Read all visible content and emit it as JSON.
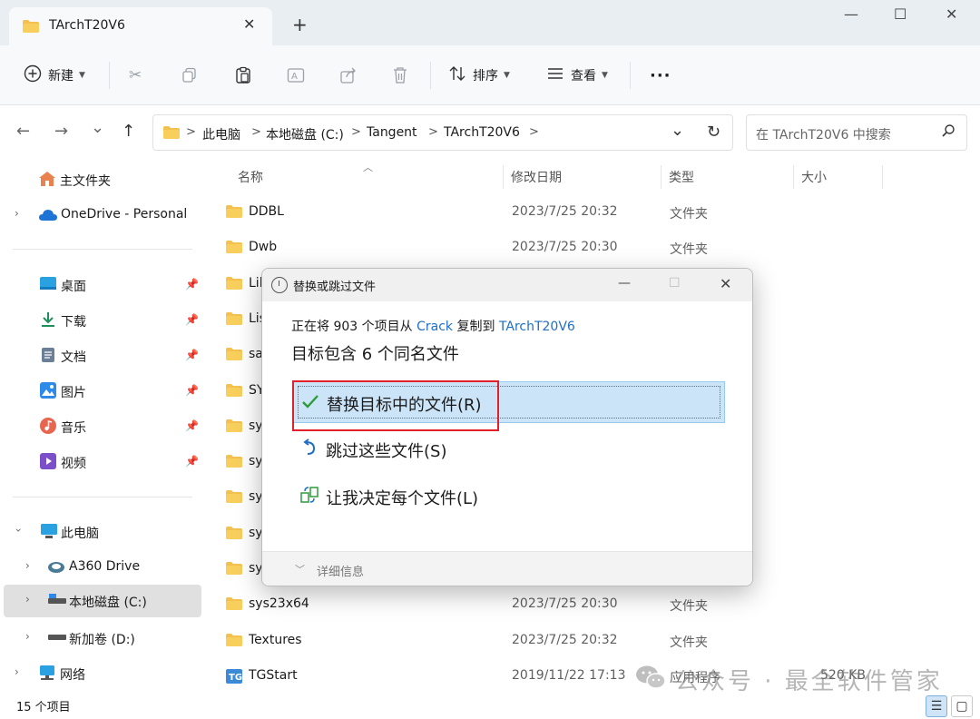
{
  "window": {
    "tab_title": "TArchT20V6",
    "tab_close": "✕",
    "new_tab": "+",
    "minimize": "—",
    "maximize": "☐",
    "close": "✕"
  },
  "toolbar": {
    "new_label": "新建",
    "sort_label": "排序",
    "view_label": "查看",
    "more_label": "···"
  },
  "address": {
    "back": "←",
    "forward": "→",
    "recent": "⌄",
    "up": "↑",
    "crumbs": [
      "此电脑",
      "本地磁盘 (C:)",
      "Tangent",
      "TArchT20V6"
    ],
    "separator": ">",
    "dropdown": "⌄",
    "refresh": "↻",
    "search_placeholder": "在 TArchT20V6 中搜索"
  },
  "sidebar": {
    "items": [
      {
        "label": "主文件夹"
      },
      {
        "label": "OneDrive - Personal"
      },
      {
        "label": "桌面"
      },
      {
        "label": "下载"
      },
      {
        "label": "文档"
      },
      {
        "label": "图片"
      },
      {
        "label": "音乐"
      },
      {
        "label": "视频"
      },
      {
        "label": "此电脑"
      },
      {
        "label": "A360 Drive"
      },
      {
        "label": "本地磁盘 (C:)"
      },
      {
        "label": "新加卷 (D:)"
      },
      {
        "label": "网络"
      }
    ]
  },
  "columns": {
    "name": "名称",
    "modified": "修改日期",
    "type": "类型",
    "size": "大小"
  },
  "files": [
    {
      "name": "DDBL",
      "date": "2023/7/25 20:32",
      "type": "文件夹",
      "size": ""
    },
    {
      "name": "Dwb",
      "date": "2023/7/25 20:30",
      "type": "文件夹",
      "size": ""
    },
    {
      "name": "Lil",
      "date": "",
      "type": "",
      "size": ""
    },
    {
      "name": "Lis",
      "date": "",
      "type": "",
      "size": ""
    },
    {
      "name": "sa",
      "date": "",
      "type": "",
      "size": ""
    },
    {
      "name": "SY",
      "date": "",
      "type": "",
      "size": ""
    },
    {
      "name": "sys",
      "date": "",
      "type": "",
      "size": ""
    },
    {
      "name": "sys",
      "date": "",
      "type": "",
      "size": ""
    },
    {
      "name": "sy",
      "date": "",
      "type": "",
      "size": ""
    },
    {
      "name": "sy",
      "date": "",
      "type": "",
      "size": ""
    },
    {
      "name": "sy",
      "date": "",
      "type": "",
      "size": ""
    },
    {
      "name": "sys23x64",
      "date": "2023/7/25 20:30",
      "type": "文件夹",
      "size": ""
    },
    {
      "name": "Textures",
      "date": "2023/7/25 20:32",
      "type": "文件夹",
      "size": ""
    },
    {
      "name": "TGStart",
      "date": "2019/11/22 17:13",
      "type": "应用程序",
      "size": "520 KB"
    }
  ],
  "status": {
    "count": "15 个项目"
  },
  "dialog": {
    "title": "替换或跳过文件",
    "copy_prefix": "正在将 903 个项目从 ",
    "source": "Crack",
    "copy_middle": " 复制到 ",
    "destination": "TArchT20V6",
    "heading": "目标包含 6 个同名文件",
    "options": [
      {
        "label": "替换目标中的文件(R)"
      },
      {
        "label": "跳过这些文件(S)"
      },
      {
        "label": "让我决定每个文件(L)"
      }
    ],
    "details": "详细信息"
  },
  "watermark": {
    "text": "公众号 · 最全软件管家"
  },
  "colors": {
    "accent": "#1f6fc5",
    "highlight": "#cce4f7",
    "red_box": "#e2202a",
    "folder": "#f4c14e"
  }
}
